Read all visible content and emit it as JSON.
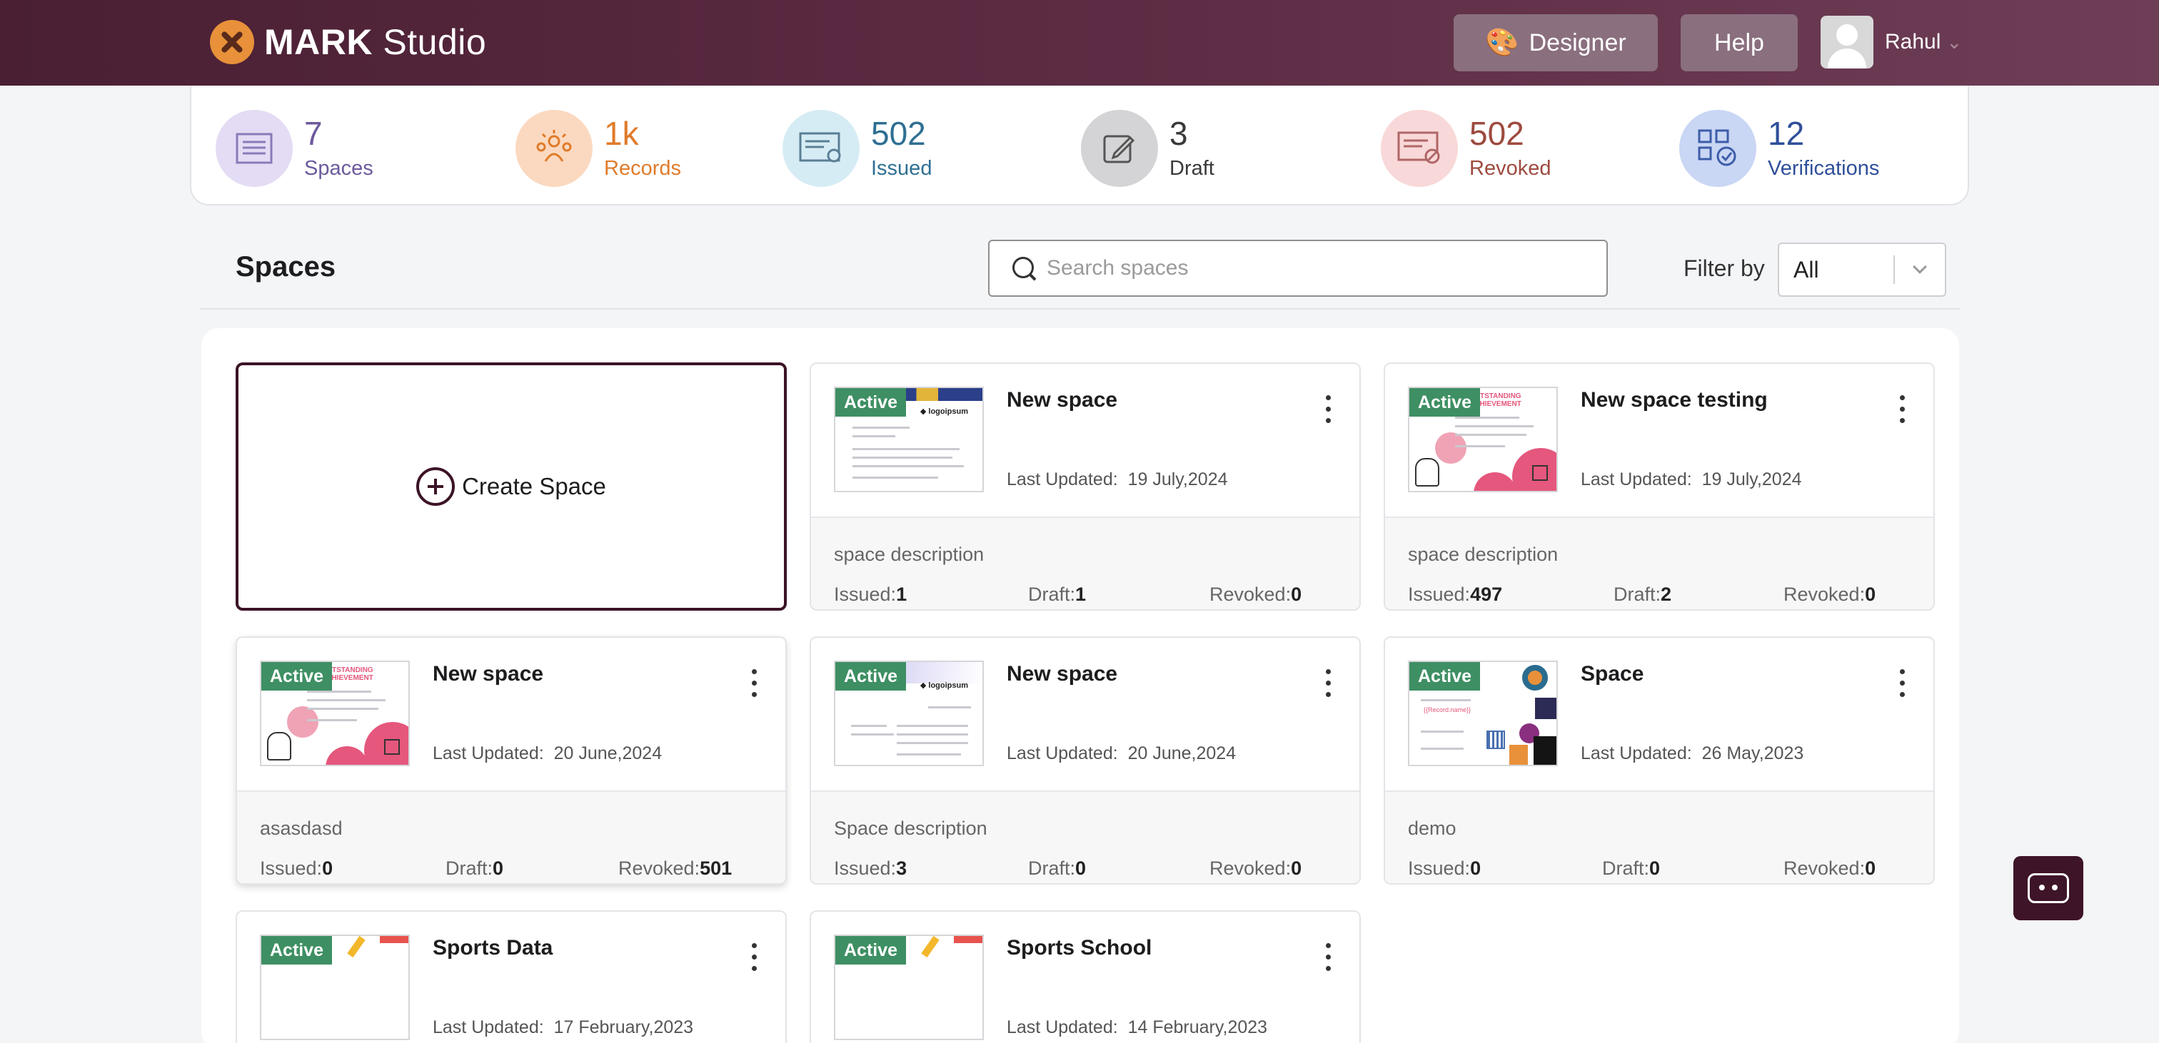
{
  "header": {
    "brand_bold": "MARK",
    "brand_rest": "Studio",
    "designer_label": "Designer",
    "help_label": "Help",
    "user_name": "Rahul"
  },
  "stats": [
    {
      "value": "7",
      "label": "Spaces",
      "color": "#6c5a9c",
      "icon_bg": "#e4dcf4",
      "icon": "document-icon"
    },
    {
      "value": "1k",
      "label": "Records",
      "color": "#e07b2a",
      "icon_bg": "#fbd9c0",
      "icon": "people-icon"
    },
    {
      "value": "502",
      "label": "Issued",
      "color": "#2f6f93",
      "icon_bg": "#d6ecf5",
      "icon": "certificate-icon"
    },
    {
      "value": "3",
      "label": "Draft",
      "color": "#3a3a3a",
      "icon_bg": "#d4d4d6",
      "icon": "pencil-icon"
    },
    {
      "value": "502",
      "label": "Revoked",
      "color": "#9e4a3f",
      "icon_bg": "#f8d8d8",
      "icon": "revoked-certificate-icon"
    },
    {
      "value": "12",
      "label": "Verifications",
      "color": "#2f4f9a",
      "icon_bg": "#c9d6f4",
      "icon": "qr-verify-icon"
    }
  ],
  "section": {
    "title": "Spaces",
    "search_placeholder": "Search spaces",
    "filter_label": "Filter by",
    "filter_value": "All"
  },
  "create_label": "Create Space",
  "cards": [
    {
      "status": "Active",
      "title": "New space",
      "updated_label": "Last Updated:",
      "updated": "19 July,2024",
      "description": "space description",
      "issued_label": "Issued:",
      "issued": "1",
      "draft_label": "Draft:",
      "draft": "1",
      "revoked_label": "Revoked:",
      "revoked": "0"
    },
    {
      "status": "Active",
      "title": "New space testing",
      "updated_label": "Last Updated:",
      "updated": "19 July,2024",
      "description": "space description",
      "issued_label": "Issued:",
      "issued": "497",
      "draft_label": "Draft:",
      "draft": "2",
      "revoked_label": "Revoked:",
      "revoked": "0"
    },
    {
      "status": "Active",
      "title": "New space",
      "updated_label": "Last Updated:",
      "updated": "20 June,2024",
      "description": "asasdasd",
      "issued_label": "Issued:",
      "issued": "0",
      "draft_label": "Draft:",
      "draft": "0",
      "revoked_label": "Revoked:",
      "revoked": "501"
    },
    {
      "status": "Active",
      "title": "New space",
      "updated_label": "Last Updated:",
      "updated": "20 June,2024",
      "description": "Space description",
      "issued_label": "Issued:",
      "issued": "3",
      "draft_label": "Draft:",
      "draft": "0",
      "revoked_label": "Revoked:",
      "revoked": "0"
    },
    {
      "status": "Active",
      "title": "Space",
      "updated_label": "Last Updated:",
      "updated": "26 May,2023",
      "description": "demo",
      "issued_label": "Issued:",
      "issued": "0",
      "draft_label": "Draft:",
      "draft": "0",
      "revoked_label": "Revoked:",
      "revoked": "0"
    },
    {
      "status": "Active",
      "title": "Sports Data",
      "updated_label": "Last Updated:",
      "updated": "17 February,2023"
    },
    {
      "status": "Active",
      "title": "Sports School",
      "updated_label": "Last Updated:",
      "updated": "14 February,2023"
    }
  ]
}
